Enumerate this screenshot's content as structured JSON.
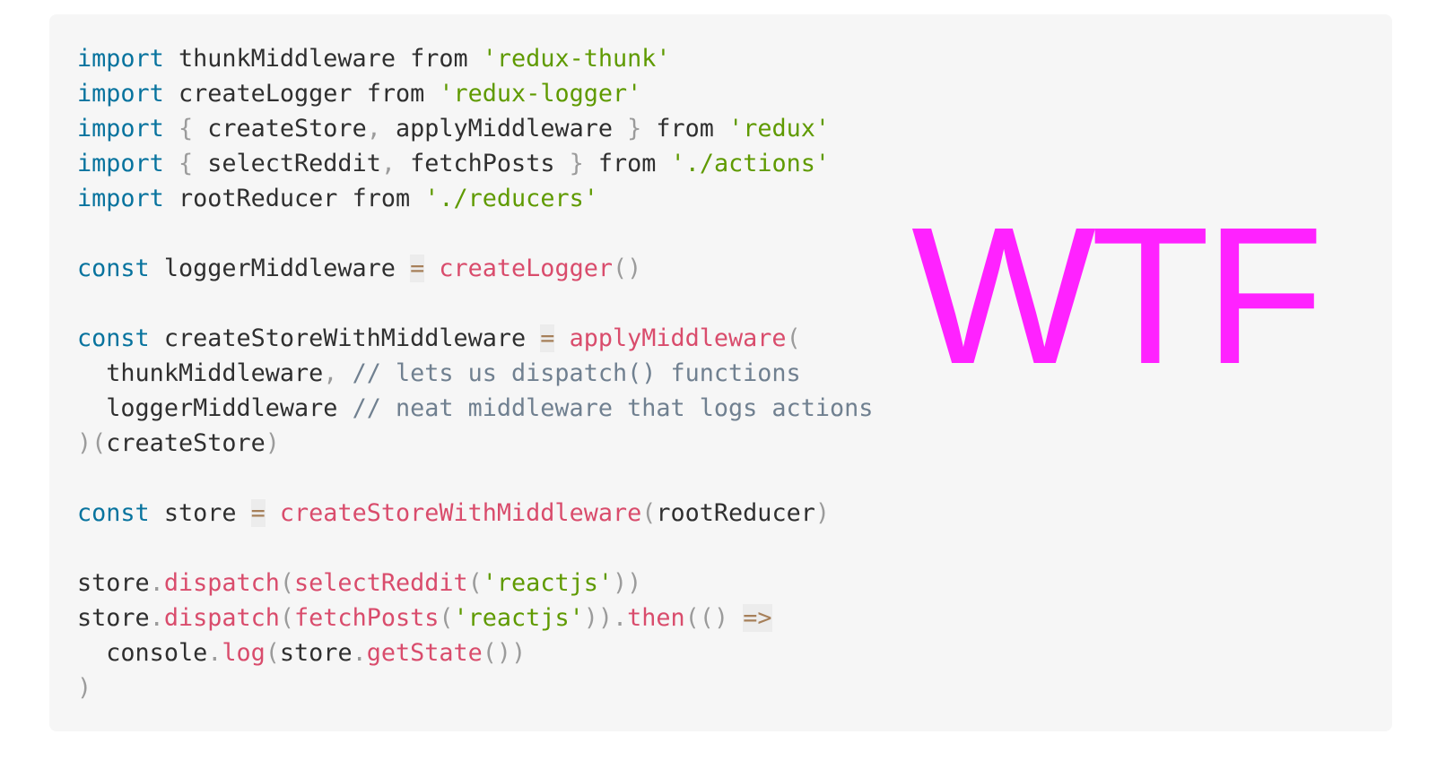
{
  "overlay": {
    "text": "WTF",
    "color": "#ff22ff"
  },
  "code": {
    "language": "javascript",
    "lines": [
      [
        {
          "t": "keyword",
          "v": "import"
        },
        {
          "t": "space",
          "v": " "
        },
        {
          "t": "ident",
          "v": "thunkMiddleware"
        },
        {
          "t": "space",
          "v": " "
        },
        {
          "t": "ident",
          "v": "from"
        },
        {
          "t": "space",
          "v": " "
        },
        {
          "t": "string",
          "v": "'redux-thunk'"
        }
      ],
      [
        {
          "t": "keyword",
          "v": "import"
        },
        {
          "t": "space",
          "v": " "
        },
        {
          "t": "ident",
          "v": "createLogger"
        },
        {
          "t": "space",
          "v": " "
        },
        {
          "t": "ident",
          "v": "from"
        },
        {
          "t": "space",
          "v": " "
        },
        {
          "t": "string",
          "v": "'redux-logger'"
        }
      ],
      [
        {
          "t": "keyword",
          "v": "import"
        },
        {
          "t": "space",
          "v": " "
        },
        {
          "t": "punct",
          "v": "{"
        },
        {
          "t": "space",
          "v": " "
        },
        {
          "t": "ident",
          "v": "createStore"
        },
        {
          "t": "punct",
          "v": ","
        },
        {
          "t": "space",
          "v": " "
        },
        {
          "t": "ident",
          "v": "applyMiddleware"
        },
        {
          "t": "space",
          "v": " "
        },
        {
          "t": "punct",
          "v": "}"
        },
        {
          "t": "space",
          "v": " "
        },
        {
          "t": "ident",
          "v": "from"
        },
        {
          "t": "space",
          "v": " "
        },
        {
          "t": "string",
          "v": "'redux'"
        }
      ],
      [
        {
          "t": "keyword",
          "v": "import"
        },
        {
          "t": "space",
          "v": " "
        },
        {
          "t": "punct",
          "v": "{"
        },
        {
          "t": "space",
          "v": " "
        },
        {
          "t": "ident",
          "v": "selectReddit"
        },
        {
          "t": "punct",
          "v": ","
        },
        {
          "t": "space",
          "v": " "
        },
        {
          "t": "ident",
          "v": "fetchPosts"
        },
        {
          "t": "space",
          "v": " "
        },
        {
          "t": "punct",
          "v": "}"
        },
        {
          "t": "space",
          "v": " "
        },
        {
          "t": "ident",
          "v": "from"
        },
        {
          "t": "space",
          "v": " "
        },
        {
          "t": "string",
          "v": "'./actions'"
        }
      ],
      [
        {
          "t": "keyword",
          "v": "import"
        },
        {
          "t": "space",
          "v": " "
        },
        {
          "t": "ident",
          "v": "rootReducer"
        },
        {
          "t": "space",
          "v": " "
        },
        {
          "t": "ident",
          "v": "from"
        },
        {
          "t": "space",
          "v": " "
        },
        {
          "t": "string",
          "v": "'./reducers'"
        }
      ],
      [],
      [
        {
          "t": "keyword",
          "v": "const"
        },
        {
          "t": "space",
          "v": " "
        },
        {
          "t": "ident",
          "v": "loggerMiddleware"
        },
        {
          "t": "space",
          "v": " "
        },
        {
          "t": "operator",
          "v": "="
        },
        {
          "t": "space",
          "v": " "
        },
        {
          "t": "function",
          "v": "createLogger"
        },
        {
          "t": "punct",
          "v": "()"
        }
      ],
      [],
      [
        {
          "t": "keyword",
          "v": "const"
        },
        {
          "t": "space",
          "v": " "
        },
        {
          "t": "ident",
          "v": "createStoreWithMiddleware"
        },
        {
          "t": "space",
          "v": " "
        },
        {
          "t": "operator",
          "v": "="
        },
        {
          "t": "space",
          "v": " "
        },
        {
          "t": "function",
          "v": "applyMiddleware"
        },
        {
          "t": "punct",
          "v": "("
        }
      ],
      [
        {
          "t": "space",
          "v": "  "
        },
        {
          "t": "ident",
          "v": "thunkMiddleware"
        },
        {
          "t": "punct",
          "v": ","
        },
        {
          "t": "space",
          "v": " "
        },
        {
          "t": "comment",
          "v": "// lets us dispatch() functions"
        }
      ],
      [
        {
          "t": "space",
          "v": "  "
        },
        {
          "t": "ident",
          "v": "loggerMiddleware"
        },
        {
          "t": "space",
          "v": " "
        },
        {
          "t": "comment",
          "v": "// neat middleware that logs actions"
        }
      ],
      [
        {
          "t": "punct",
          "v": ")("
        },
        {
          "t": "ident",
          "v": "createStore"
        },
        {
          "t": "punct",
          "v": ")"
        }
      ],
      [],
      [
        {
          "t": "keyword",
          "v": "const"
        },
        {
          "t": "space",
          "v": " "
        },
        {
          "t": "ident",
          "v": "store"
        },
        {
          "t": "space",
          "v": " "
        },
        {
          "t": "operator",
          "v": "="
        },
        {
          "t": "space",
          "v": " "
        },
        {
          "t": "function",
          "v": "createStoreWithMiddleware"
        },
        {
          "t": "punct",
          "v": "("
        },
        {
          "t": "ident",
          "v": "rootReducer"
        },
        {
          "t": "punct",
          "v": ")"
        }
      ],
      [],
      [
        {
          "t": "ident",
          "v": "store"
        },
        {
          "t": "punct",
          "v": "."
        },
        {
          "t": "function",
          "v": "dispatch"
        },
        {
          "t": "punct",
          "v": "("
        },
        {
          "t": "function",
          "v": "selectReddit"
        },
        {
          "t": "punct",
          "v": "("
        },
        {
          "t": "string",
          "v": "'reactjs'"
        },
        {
          "t": "punct",
          "v": "))"
        }
      ],
      [
        {
          "t": "ident",
          "v": "store"
        },
        {
          "t": "punct",
          "v": "."
        },
        {
          "t": "function",
          "v": "dispatch"
        },
        {
          "t": "punct",
          "v": "("
        },
        {
          "t": "function",
          "v": "fetchPosts"
        },
        {
          "t": "punct",
          "v": "("
        },
        {
          "t": "string",
          "v": "'reactjs'"
        },
        {
          "t": "punct",
          "v": "))."
        },
        {
          "t": "function",
          "v": "then"
        },
        {
          "t": "punct",
          "v": "(()"
        },
        {
          "t": "space",
          "v": " "
        },
        {
          "t": "operator",
          "v": "=>"
        }
      ],
      [
        {
          "t": "space",
          "v": "  "
        },
        {
          "t": "ident",
          "v": "console"
        },
        {
          "t": "punct",
          "v": "."
        },
        {
          "t": "function",
          "v": "log"
        },
        {
          "t": "punct",
          "v": "("
        },
        {
          "t": "ident",
          "v": "store"
        },
        {
          "t": "punct",
          "v": "."
        },
        {
          "t": "function",
          "v": "getState"
        },
        {
          "t": "punct",
          "v": "())"
        }
      ],
      [
        {
          "t": "punct",
          "v": ")"
        }
      ]
    ]
  }
}
